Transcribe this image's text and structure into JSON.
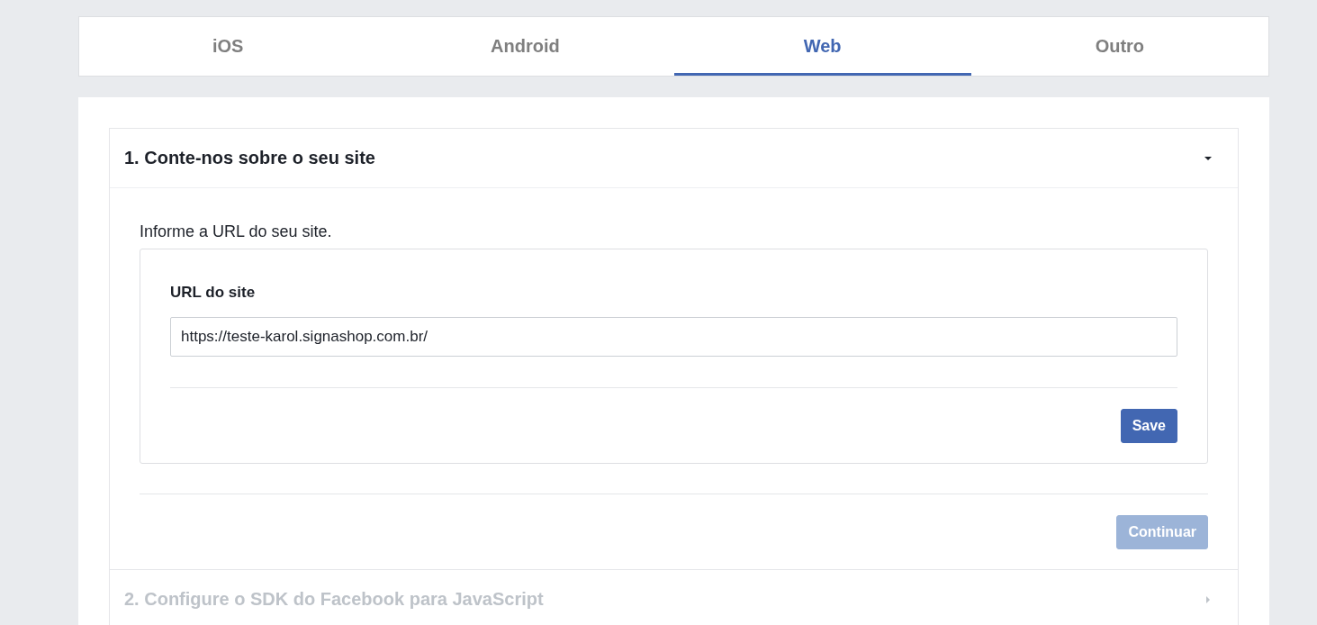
{
  "tabs": [
    {
      "label": "iOS",
      "selected": false
    },
    {
      "label": "Android",
      "selected": false
    },
    {
      "label": "Web",
      "selected": true
    },
    {
      "label": "Outro",
      "selected": false
    }
  ],
  "sections": [
    {
      "title": "1. Conte-nos sobre o seu site",
      "expanded": true,
      "disabled": false,
      "body": {
        "instruction": "Informe a URL do seu site.",
        "field_label": "URL do site",
        "field_value": "https://teste-karol.signashop.com.br/",
        "save_button": {
          "label": "Save",
          "disabled": false
        },
        "continue_button": {
          "label": "Continuar",
          "disabled": true
        }
      }
    },
    {
      "title": "2. Configure o SDK do Facebook para JavaScript",
      "expanded": false,
      "disabled": true
    }
  ]
}
